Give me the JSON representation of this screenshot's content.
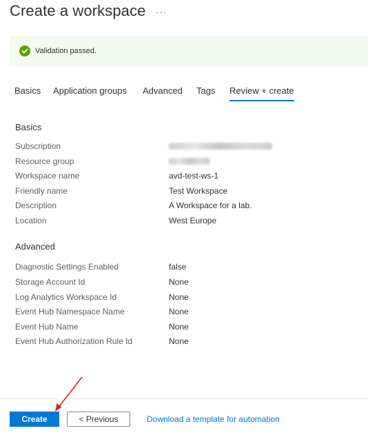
{
  "page": {
    "title": "Create a workspace",
    "more_label": "···"
  },
  "banner": {
    "message": "Validation passed.",
    "icon": "check-circle-icon",
    "color": "#57a300"
  },
  "tabs": [
    {
      "label": "Basics"
    },
    {
      "label": "Application groups"
    },
    {
      "label": "Advanced"
    },
    {
      "label": "Tags"
    },
    {
      "label": "Review + create",
      "active": true
    }
  ],
  "basics": {
    "title": "Basics",
    "rows": [
      {
        "label": "Subscription",
        "value": ""
      },
      {
        "label": "Resource group",
        "value": ""
      },
      {
        "label": "Workspace name",
        "value": "avd-test-ws-1"
      },
      {
        "label": "Friendly name",
        "value": "Test Workspace"
      },
      {
        "label": "Description",
        "value": "A Workspace for a lab."
      },
      {
        "label": "Location",
        "value": "West Europe"
      }
    ]
  },
  "advanced": {
    "title": "Advanced",
    "rows": [
      {
        "label": "Diagnostic Settings Enabled",
        "value": "false"
      },
      {
        "label": "Storage Account Id",
        "value": "None"
      },
      {
        "label": "Log Analytics Workspace Id",
        "value": "None"
      },
      {
        "label": "Event Hub Namespace Name",
        "value": "None"
      },
      {
        "label": "Event Hub Name",
        "value": "None"
      },
      {
        "label": "Event Hub Authorization Rule Id",
        "value": "None"
      }
    ]
  },
  "footer": {
    "create_label": "Create",
    "previous_label": "< Previous",
    "template_link": "Download a template for automation"
  },
  "colors": {
    "accent": "#0078d4",
    "annotation_arrow": "#e0201b"
  }
}
